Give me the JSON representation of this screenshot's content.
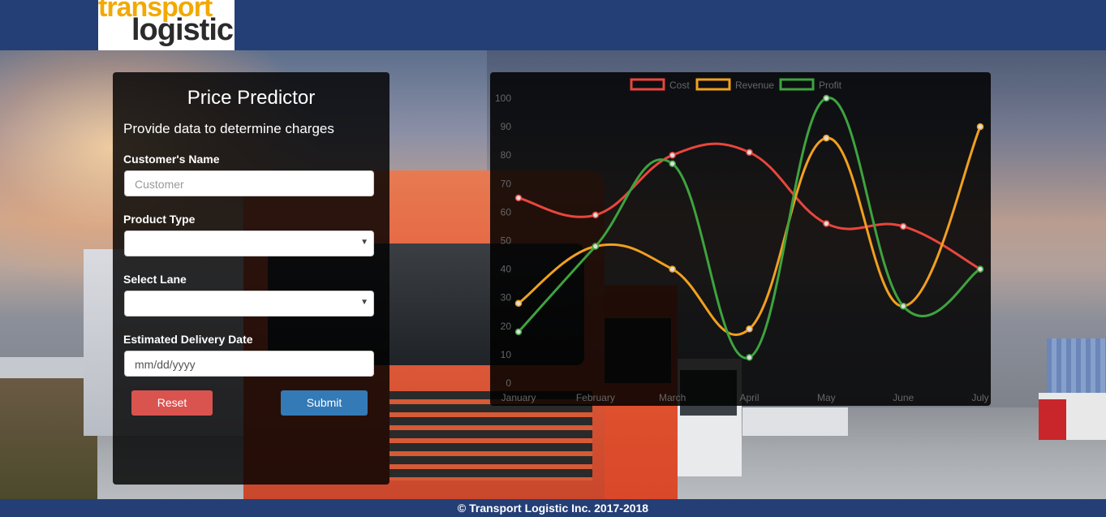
{
  "header": {
    "logo_line1": "transport",
    "logo_line2": "logistic"
  },
  "form": {
    "title": "Price Predictor",
    "subtitle": "Provide data to determine charges",
    "customer_label": "Customer's Name",
    "customer_placeholder": "Customer",
    "customer_value": "",
    "product_label": "Product Type",
    "product_value": "",
    "lane_label": "Select Lane",
    "lane_value": "",
    "date_label": "Estimated Delivery Date",
    "date_placeholder": "mm/dd/yyyy",
    "reset_label": "Reset",
    "submit_label": "Submit",
    "colors": {
      "reset": "#d9534f",
      "submit": "#337ab7"
    }
  },
  "chart_data": {
    "type": "line",
    "categories": [
      "January",
      "February",
      "March",
      "April",
      "May",
      "June",
      "July"
    ],
    "ylim": [
      0,
      100
    ],
    "yticks": [
      0,
      10,
      20,
      30,
      40,
      50,
      60,
      70,
      80,
      90,
      100
    ],
    "legend_position": "top-center",
    "grid": false,
    "series": [
      {
        "name": "Cost",
        "color": "#e8463d",
        "values": [
          65,
          59,
          80,
          81,
          56,
          55,
          40
        ]
      },
      {
        "name": "Revenue",
        "color": "#f0a020",
        "values": [
          28,
          48,
          40,
          19,
          86,
          27,
          90
        ]
      },
      {
        "name": "Profit",
        "color": "#3ea33e",
        "values": [
          18,
          48,
          77,
          9,
          100,
          27,
          40
        ]
      }
    ]
  },
  "footer": {
    "text": "© Transport Logistic Inc. 2017-2018"
  }
}
